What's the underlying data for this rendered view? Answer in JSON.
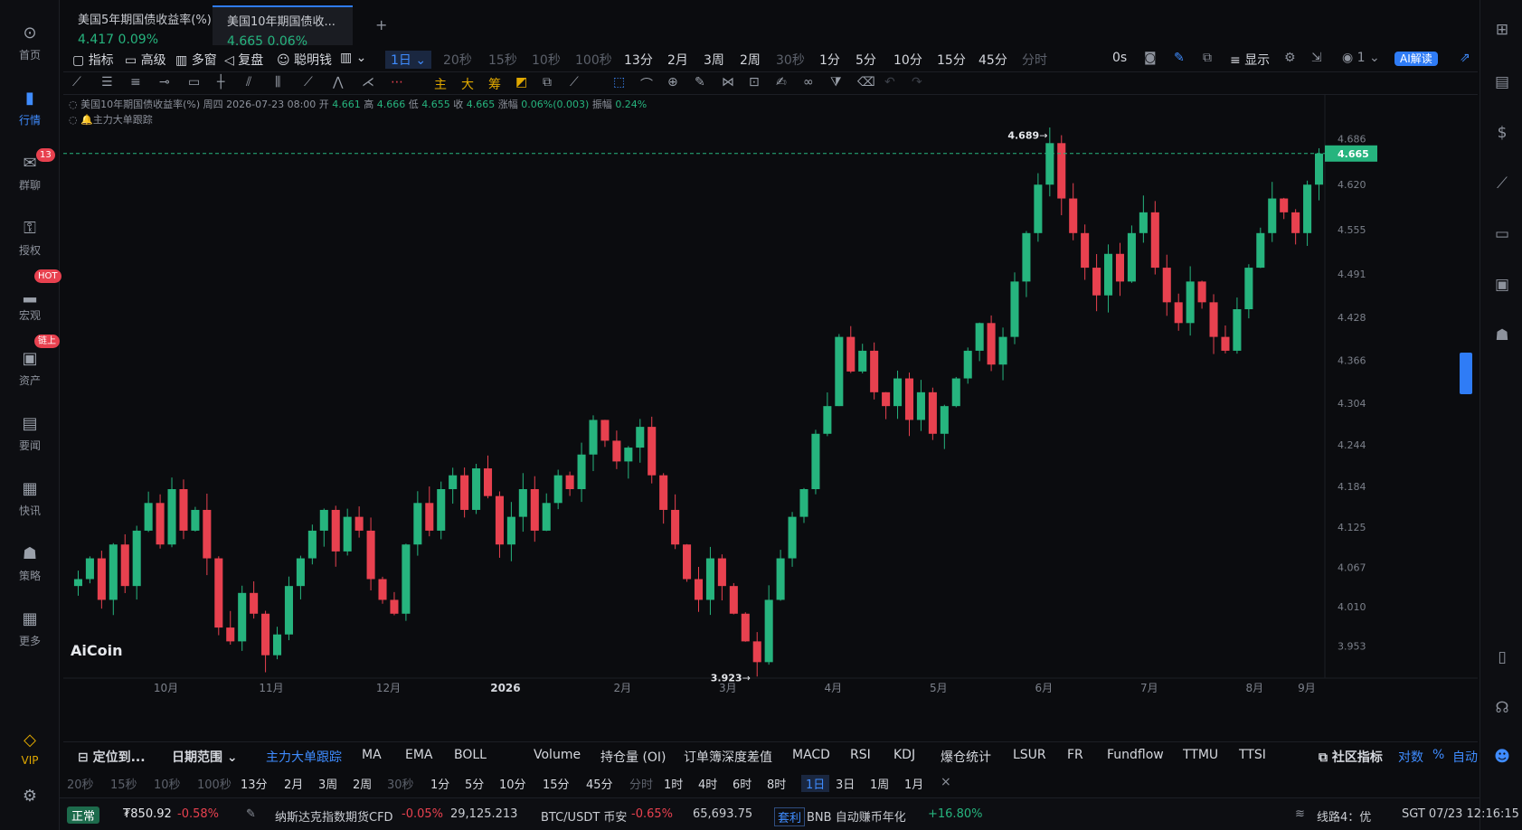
{
  "left_nav": [
    {
      "label": "首页",
      "icon": "home-icon"
    },
    {
      "label": "行情",
      "icon": "market-icon",
      "active": true
    },
    {
      "label": "群聊",
      "icon": "chat-icon",
      "badge": "13"
    },
    {
      "label": "授权",
      "icon": "auth-icon"
    },
    {
      "label": "宏观",
      "icon": "macro-icon",
      "badge": "HOT"
    },
    {
      "label": "资产",
      "icon": "wallet-icon",
      "badge": "链上"
    },
    {
      "label": "要闻",
      "icon": "news-icon"
    },
    {
      "label": "快讯",
      "icon": "flash-icon"
    },
    {
      "label": "策略",
      "icon": "robot-icon"
    },
    {
      "label": "更多",
      "icon": "grid-icon"
    },
    {
      "label": "VIP",
      "icon": "diamond-icon"
    }
  ],
  "tabs": [
    {
      "name": "美国5年期国债收益率(%)",
      "price": "4.417",
      "change": "0.09%"
    },
    {
      "name": "美国10年期国债收...",
      "price": "4.665",
      "change": "0.06%"
    }
  ],
  "toolbar": {
    "left": [
      "指标",
      "高级",
      "多窗",
      "复盘",
      "聪明钱"
    ],
    "current_period": "1日",
    "periods": [
      "20秒",
      "15秒",
      "10秒",
      "100秒",
      "13分",
      "2月",
      "3周",
      "2周",
      "30秒",
      "1分",
      "5分",
      "10分",
      "15分",
      "45分",
      "分时"
    ],
    "right": [
      "0s",
      "显示",
      "1",
      "AI解读"
    ]
  },
  "info": {
    "symbol": "美国10年期国债收益率(%)",
    "date": "周四 2026-07-23 08:00",
    "open_label": "开",
    "open": "4.661",
    "high_label": "高",
    "high": "4.666",
    "low_label": "低",
    "low": "4.655",
    "close_label": "收",
    "close": "4.665",
    "chg_label": "涨幅",
    "chg": "0.06%(0.003)",
    "amp_label": "振幅",
    "amp": "0.24%",
    "indicator": "主力大单跟踪"
  },
  "chart_data": {
    "type": "candlestick",
    "y_ticks": [
      "4.686",
      "4.620",
      "4.555",
      "4.491",
      "4.428",
      "4.366",
      "4.304",
      "4.244",
      "4.184",
      "4.125",
      "4.067",
      "4.010",
      "3.953"
    ],
    "x_ticks": [
      "10月",
      "11月",
      "12月",
      "2026",
      "2月",
      "3月",
      "4月",
      "5月",
      "6月",
      "7月",
      "8月",
      "9月"
    ],
    "ylim": [
      3.92,
      4.7
    ],
    "last_price": "4.665",
    "high_marker": "4.689",
    "low_marker": "3.923",
    "up_color": "#26b47e",
    "down_color": "#e8414f",
    "watermark": "AiCoin",
    "closes": [
      4.05,
      4.08,
      4.02,
      4.1,
      4.04,
      4.12,
      4.16,
      4.1,
      4.18,
      4.12,
      4.15,
      4.08,
      3.98,
      3.96,
      4.03,
      4.0,
      3.94,
      3.97,
      4.04,
      4.08,
      4.12,
      4.15,
      4.09,
      4.14,
      4.12,
      4.05,
      4.02,
      4.0,
      4.1,
      4.16,
      4.12,
      4.18,
      4.2,
      4.15,
      4.21,
      4.17,
      4.1,
      4.14,
      4.18,
      4.12,
      4.16,
      4.2,
      4.18,
      4.23,
      4.28,
      4.25,
      4.22,
      4.24,
      4.27,
      4.2,
      4.15,
      4.1,
      4.05,
      4.02,
      4.08,
      4.04,
      4.0,
      3.96,
      3.93,
      4.02,
      4.08,
      4.14,
      4.18,
      4.26,
      4.3,
      4.4,
      4.35,
      4.38,
      4.32,
      4.3,
      4.34,
      4.28,
      4.32,
      4.26,
      4.3,
      4.34,
      4.38,
      4.42,
      4.36,
      4.4,
      4.48,
      4.55,
      4.62,
      4.68,
      4.6,
      4.55,
      4.5,
      4.46,
      4.52,
      4.48,
      4.55,
      4.58,
      4.5,
      4.45,
      4.42,
      4.48,
      4.45,
      4.4,
      4.38,
      4.44,
      4.5,
      4.55,
      4.6,
      4.58,
      4.55,
      4.62,
      4.665
    ]
  },
  "bottom_indicators": [
    "主力大单跟踪",
    "MA",
    "EMA",
    "BOLL",
    "Volume",
    "持仓量 (OI)",
    "订单簿深度差值",
    "MACD",
    "RSI",
    "KDJ",
    "爆仓统计",
    "LSUR",
    "FR",
    "Fundflow",
    "TTMU",
    "TTSI"
  ],
  "bottom_left": [
    "定位到...",
    "日期范围"
  ],
  "bottom_right": [
    "社区指标",
    "对数",
    "%",
    "自动"
  ],
  "bottom_periods": [
    "20秒",
    "15秒",
    "10秒",
    "100秒",
    "13分",
    "2月",
    "3周",
    "2周",
    "30秒",
    "1分",
    "5分",
    "10分",
    "15分",
    "45分",
    "分时",
    "1时",
    "4时",
    "6时",
    "8时",
    "1日",
    "3日",
    "1周",
    "1月"
  ],
  "status": {
    "state": "正常",
    "balance": "₮850.92",
    "balance_chg": "-0.58%",
    "t1_name": "纳斯达克指数期货CFD",
    "t1_chg": "-0.05%",
    "t1_price": "29,125.213",
    "t2_name": "BTC/USDT 币安",
    "t2_chg": "-0.65%",
    "t2_price": "65,693.75",
    "tag": "套利",
    "t3_name": "BNB 自动赚币年化",
    "t3_chg": "+16.80%",
    "line": "线路4：优",
    "time": "SGT 07/23 12:16:15"
  }
}
